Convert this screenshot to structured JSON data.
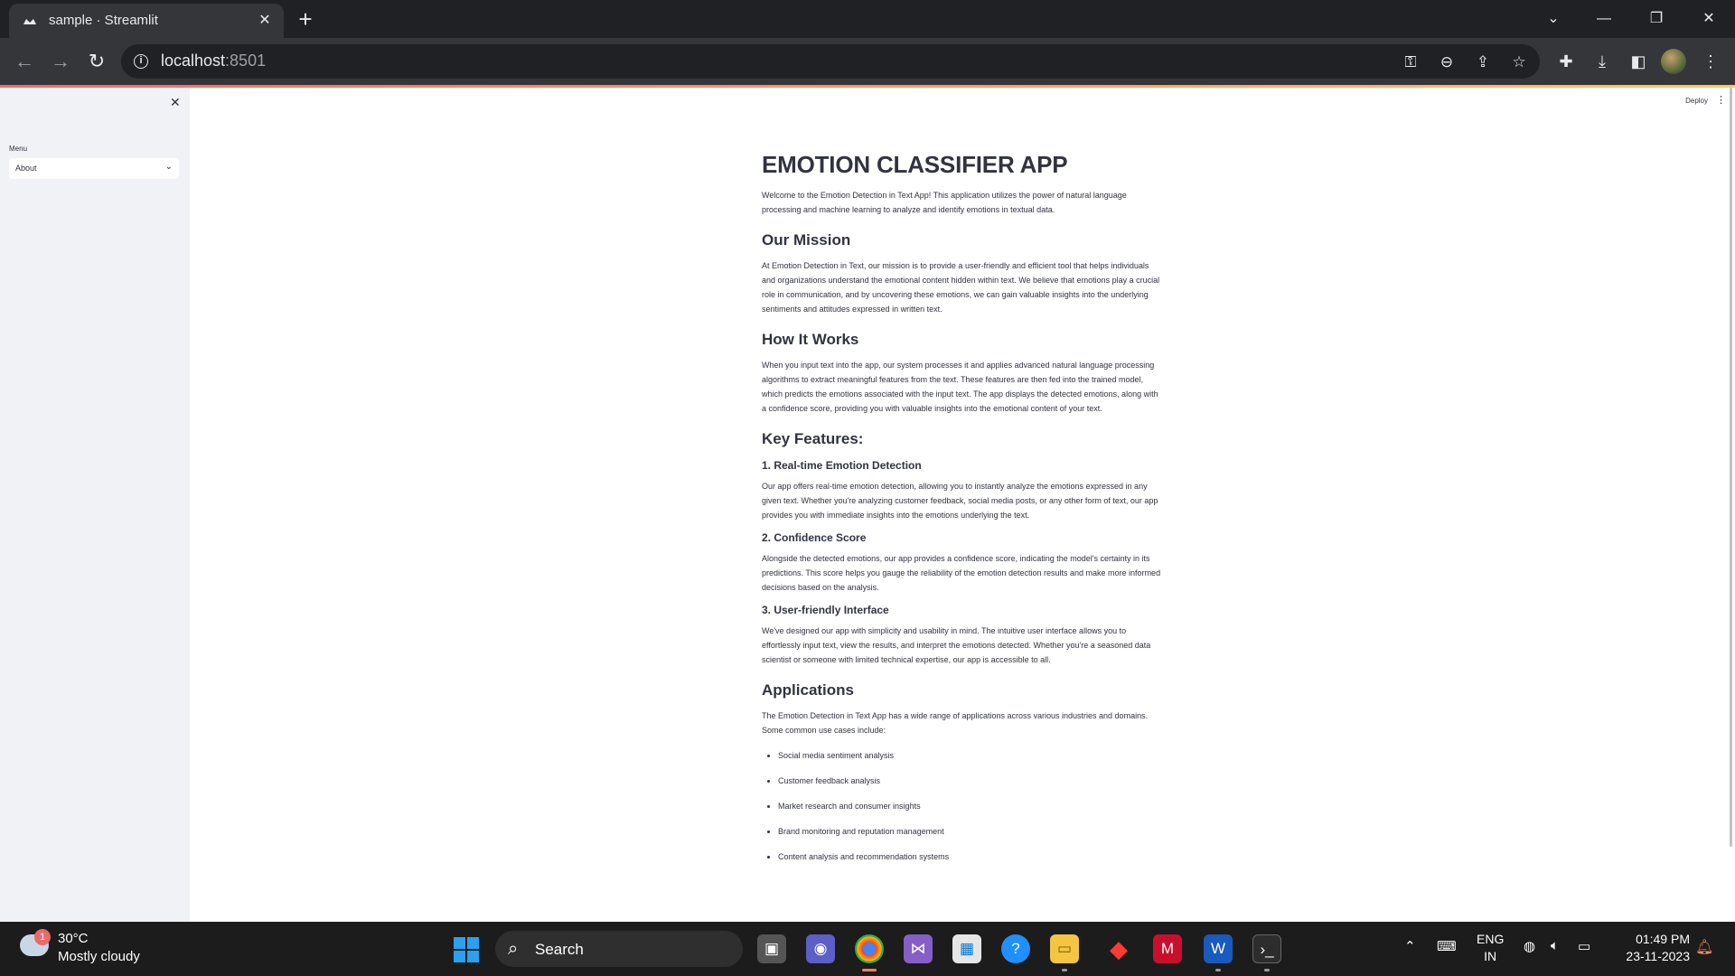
{
  "browser": {
    "tab_title": "sample · Streamlit",
    "url_host": "localhost",
    "url_port": ":8501"
  },
  "sidebar": {
    "menu_label": "Menu",
    "menu_value": "About"
  },
  "header": {
    "deploy_label": "Deploy"
  },
  "content": {
    "title": "EMOTION CLASSIFIER APP",
    "intro": "Welcome to the Emotion Detection in Text App! This application utilizes the power of natural language processing and machine learning to analyze and identify emotions in textual data.",
    "mission_heading": "Our Mission",
    "mission_text": "At Emotion Detection in Text, our mission is to provide a user-friendly and efficient tool that helps individuals and organizations understand the emotional content hidden within text. We believe that emotions play a crucial role in communication, and by uncovering these emotions, we can gain valuable insights into the underlying sentiments and attitudes expressed in written text.",
    "how_heading": "How It Works",
    "how_text": "When you input text into the app, our system processes it and applies advanced natural language processing algorithms to extract meaningful features from the text. These features are then fed into the trained model, which predicts the emotions associated with the input text. The app displays the detected emotions, along with a confidence score, providing you with valuable insights into the emotional content of your text.",
    "features_heading": "Key Features:",
    "features": [
      {
        "title": "1. Real-time Emotion Detection",
        "text": "Our app offers real-time emotion detection, allowing you to instantly analyze the emotions expressed in any given text. Whether you're analyzing customer feedback, social media posts, or any other form of text, our app provides you with immediate insights into the emotions underlying the text."
      },
      {
        "title": "2. Confidence Score",
        "text": "Alongside the detected emotions, our app provides a confidence score, indicating the model's certainty in its predictions. This score helps you gauge the reliability of the emotion detection results and make more informed decisions based on the analysis."
      },
      {
        "title": "3. User-friendly Interface",
        "text": "We've designed our app with simplicity and usability in mind. The intuitive user interface allows you to effortlessly input text, view the results, and interpret the emotions detected. Whether you're a seasoned data scientist or someone with limited technical expertise, our app is accessible to all."
      }
    ],
    "applications_heading": "Applications",
    "applications_text": "The Emotion Detection in Text App has a wide range of applications across various industries and domains. Some common use cases include:",
    "applications": [
      "Social media sentiment analysis",
      "Customer feedback analysis",
      "Market research and consumer insights",
      "Brand monitoring and reputation management",
      "Content analysis and recommendation systems"
    ]
  },
  "taskbar": {
    "weather_badge": "1",
    "weather_temp": "30°C",
    "weather_desc": "Mostly cloudy",
    "search_label": "Search",
    "lang_top": "ENG",
    "lang_bottom": "IN",
    "time": "01:49 PM",
    "date": "23-11-2023"
  }
}
